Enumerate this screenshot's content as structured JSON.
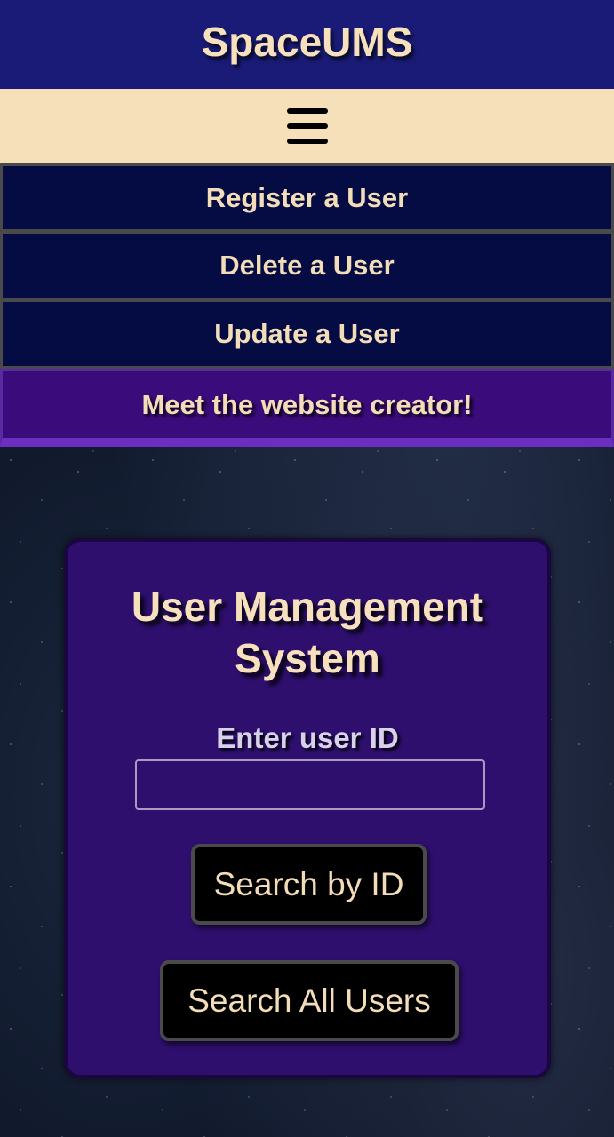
{
  "header": {
    "title": "SpaceUMS"
  },
  "menu": {
    "icon": "hamburger-menu-icon"
  },
  "nav": {
    "items": [
      {
        "label": "Register a User"
      },
      {
        "label": "Delete a User"
      },
      {
        "label": "Update a User"
      },
      {
        "label": "Meet the website creator!"
      }
    ]
  },
  "card": {
    "title": "User Management System",
    "field_label": "Enter user ID",
    "input_value": "",
    "input_placeholder": "",
    "search_by_id_label": "Search by ID",
    "search_all_label": "Search All Users"
  },
  "colors": {
    "header_bg": "#1a1b77",
    "accent_text": "#f7e0bc",
    "menu_bar_bg": "#f6e0b9",
    "nav_bg": "#050b43",
    "creator_bg": "#3a0b7a",
    "card_bg": "#2e0f6e",
    "button_bg": "#000000"
  }
}
